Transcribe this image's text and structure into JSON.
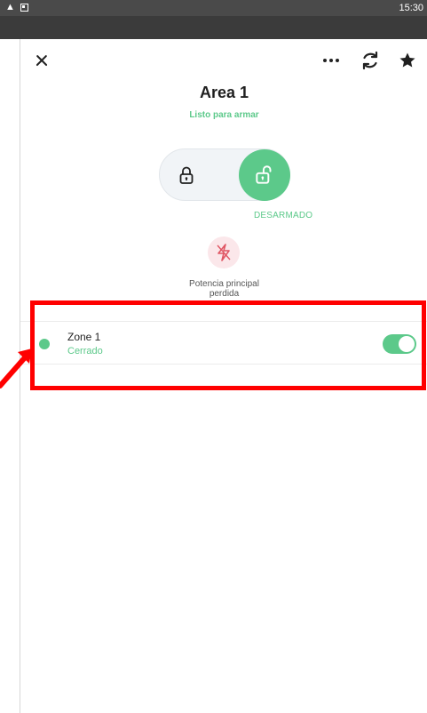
{
  "status_bar": {
    "time": "15:30",
    "icons": [
      "warning-icon",
      "notification-icon"
    ]
  },
  "toolbar": {
    "icons": [
      "close-icon",
      "more-options-icon",
      "refresh-icon",
      "star-icon"
    ]
  },
  "area": {
    "title": "Area 1",
    "status": "Listo para armar"
  },
  "arm_control": {
    "state_label": "DESARMADO",
    "icons": [
      "lock-closed-icon",
      "lock-open-icon"
    ]
  },
  "alert": {
    "line1": "Potencia principal",
    "line2": "perdida",
    "icon": "lightning-icon"
  },
  "zone": {
    "name": "Zone 1",
    "status": "Cerrado",
    "enabled": true
  },
  "colors": {
    "accent": "#5cc98a",
    "annotation": "#ff0000",
    "alert_bg": "#fbe7ea",
    "alert_icon": "#e05563"
  }
}
